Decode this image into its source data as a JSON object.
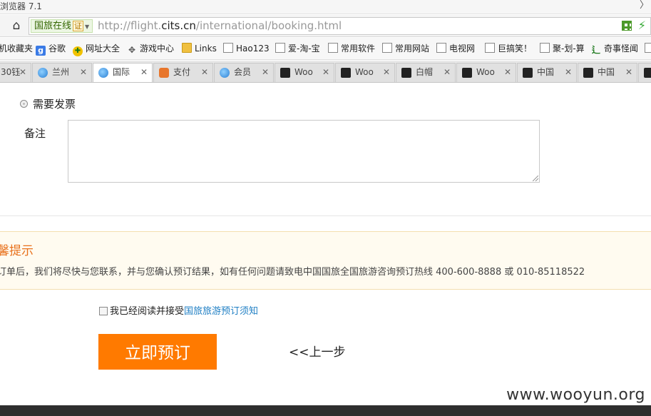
{
  "window": {
    "title": "浏览器 7.1",
    "chevron": "〉"
  },
  "addressbar": {
    "home_icon": "⌂",
    "site_badge": "国旅在线",
    "cert_badge": "证",
    "url_prefix": "http://flight.",
    "url_domain": "cits.cn",
    "url_path": "/international/booking.html",
    "bolt_icon": "⚡"
  },
  "bookmarks": [
    {
      "label": "机收藏夹",
      "icon": "none"
    },
    {
      "label": "谷歌",
      "icon": "google-icon",
      "glyph": "g"
    },
    {
      "label": "网址大全",
      "icon": "nav-icon",
      "glyph": "✚"
    },
    {
      "label": "游戏中心",
      "icon": "gamepad-icon",
      "glyph": "🎮"
    },
    {
      "label": "Links",
      "icon": "folder-icon"
    },
    {
      "label": "Hao123",
      "icon": "page-icon"
    },
    {
      "label": "爱-淘-宝",
      "icon": "page-icon"
    },
    {
      "label": "常用软件",
      "icon": "page-icon"
    },
    {
      "label": "常用网站",
      "icon": "page-icon"
    },
    {
      "label": "电视网",
      "icon": "page-icon"
    },
    {
      "label": "巨搞笑！",
      "icon": "page-icon"
    },
    {
      "label": "聚-划-算",
      "icon": "page-icon"
    },
    {
      "label": "奇事怪闻",
      "icon": "odd-icon",
      "glyph": "⻍"
    }
  ],
  "tabs": [
    {
      "label": "30钰",
      "icon": "none",
      "active": false
    },
    {
      "label": "兰州",
      "icon": "globe-icon",
      "active": false
    },
    {
      "label": "国际",
      "icon": "globe-icon",
      "active": true
    },
    {
      "label": "支付",
      "icon": "shield-icon",
      "active": false
    },
    {
      "label": "会员",
      "icon": "globe-icon",
      "active": false
    },
    {
      "label": "Woo",
      "icon": "wooyun-icon",
      "active": false
    },
    {
      "label": "Woo",
      "icon": "wooyun-icon",
      "active": false
    },
    {
      "label": "白帽",
      "icon": "wooyun-icon",
      "active": false
    },
    {
      "label": "Woo",
      "icon": "wooyun-icon",
      "active": false
    },
    {
      "label": "中国",
      "icon": "wooyun-icon",
      "active": false
    },
    {
      "label": "中国",
      "icon": "wooyun-icon",
      "active": false
    },
    {
      "label": "",
      "icon": "wooyun-icon",
      "active": false
    }
  ],
  "tab_close": "✕",
  "form": {
    "invoice_label": "需要发票",
    "remark_label": "备注",
    "remark_value": ""
  },
  "tips": {
    "title": "馨提示",
    "text": "订单后，我们将尽快与您联系，并与您确认预订结果，如有任何问题请致电中国国旅全国旅游咨询预订热线 400-600-8888 或 010-85118522"
  },
  "agreement": {
    "text": "我已经阅读并接受",
    "link": "国旅旅游预订须知"
  },
  "actions": {
    "book_now": "立即预订",
    "prev_step": "<<上一步"
  },
  "watermark": "www.wooyun.org",
  "colors": {
    "accent_orange": "#ff7a00",
    "tips_title": "#e8711c",
    "link_blue": "#1f7fc4",
    "footer": "#2e2e2e"
  }
}
